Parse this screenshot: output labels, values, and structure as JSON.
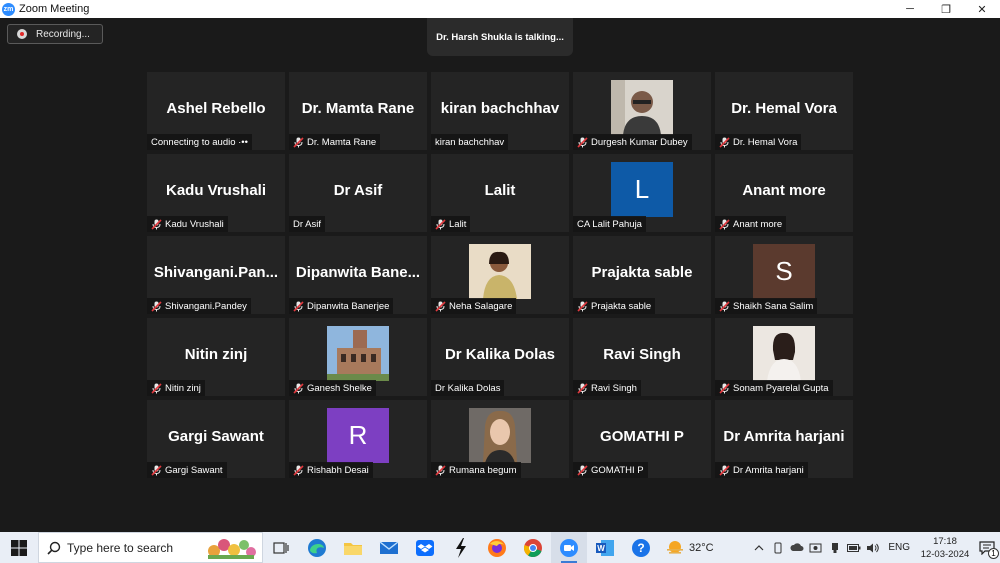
{
  "window": {
    "title": "Zoom Meeting",
    "logo_text": "zm",
    "minimize": "─",
    "restore": "❐",
    "close": "✕"
  },
  "meeting": {
    "recording_label": "Recording...",
    "talking_text": "Dr. Harsh Shukla is talking..."
  },
  "participants": [
    {
      "display": "Ashel Rebello",
      "label": "Connecting to audio ·••",
      "muted": false
    },
    {
      "display": "Dr. Mamta Rane",
      "label": "Dr. Mamta Rane",
      "muted": true
    },
    {
      "display": "kiran bachchhav",
      "label": "kiran bachchhav",
      "muted": false
    },
    {
      "display": "",
      "label": "Durgesh Kumar Dubey",
      "muted": true,
      "media": "photo-man-glasses"
    },
    {
      "display": "Dr. Hemal Vora",
      "label": "Dr. Hemal Vora",
      "muted": true
    },
    {
      "display": "Kadu Vrushali",
      "label": "Kadu Vrushali",
      "muted": true
    },
    {
      "display": "Dr Asif",
      "label": "Dr Asif",
      "muted": false
    },
    {
      "display": "Lalit",
      "label": "Lalit",
      "muted": true
    },
    {
      "display": "",
      "label": "CA Lalit Pahuja",
      "muted": false,
      "media": "letter",
      "letter": "L",
      "color": "#0e5aa7"
    },
    {
      "display": "Anant more",
      "label": "Anant more",
      "muted": true
    },
    {
      "display": "Shivangani.Pan...",
      "label": "Shivangani.Pandey",
      "muted": true
    },
    {
      "display": "Dipanwita  Bane...",
      "label": "Dipanwita Banerjee",
      "muted": true
    },
    {
      "display": "",
      "label": "Neha Salagare",
      "muted": true,
      "media": "photo-woman"
    },
    {
      "display": "Prajakta sable",
      "label": "Prajakta sable",
      "muted": true
    },
    {
      "display": "",
      "label": "Shaikh Sana Salim",
      "muted": true,
      "media": "letter",
      "letter": "S",
      "color": "#5b3a2e"
    },
    {
      "display": "Nitin zinj",
      "label": "Nitin zinj",
      "muted": true
    },
    {
      "display": "",
      "label": "Ganesh Shelke",
      "muted": true,
      "media": "photo-building"
    },
    {
      "display": "Dr Kalika Dolas",
      "label": "Dr Kalika Dolas",
      "muted": false
    },
    {
      "display": "Ravi Singh",
      "label": "Ravi Singh",
      "muted": true
    },
    {
      "display": "",
      "label": "Sonam Pyarelal Gupta",
      "muted": true,
      "media": "photo-woman-light"
    },
    {
      "display": "Gargi Sawant",
      "label": "Gargi Sawant",
      "muted": true
    },
    {
      "display": "",
      "label": "Rishabh Desai",
      "muted": true,
      "media": "letter",
      "letter": "R",
      "color": "#7d3fc2"
    },
    {
      "display": "",
      "label": "Rumana begum",
      "muted": true,
      "media": "photo-portrait"
    },
    {
      "display": "GOMATHI P",
      "label": "GOMATHI P",
      "muted": true
    },
    {
      "display": "Dr Amrita harjani",
      "label": "Dr Amrita harjani",
      "muted": true
    }
  ],
  "taskbar": {
    "search_placeholder": "Type here to search",
    "weather": "32°C",
    "language": "ENG",
    "time": "17:18",
    "date": "12-03-2024",
    "notification_count": "1"
  }
}
